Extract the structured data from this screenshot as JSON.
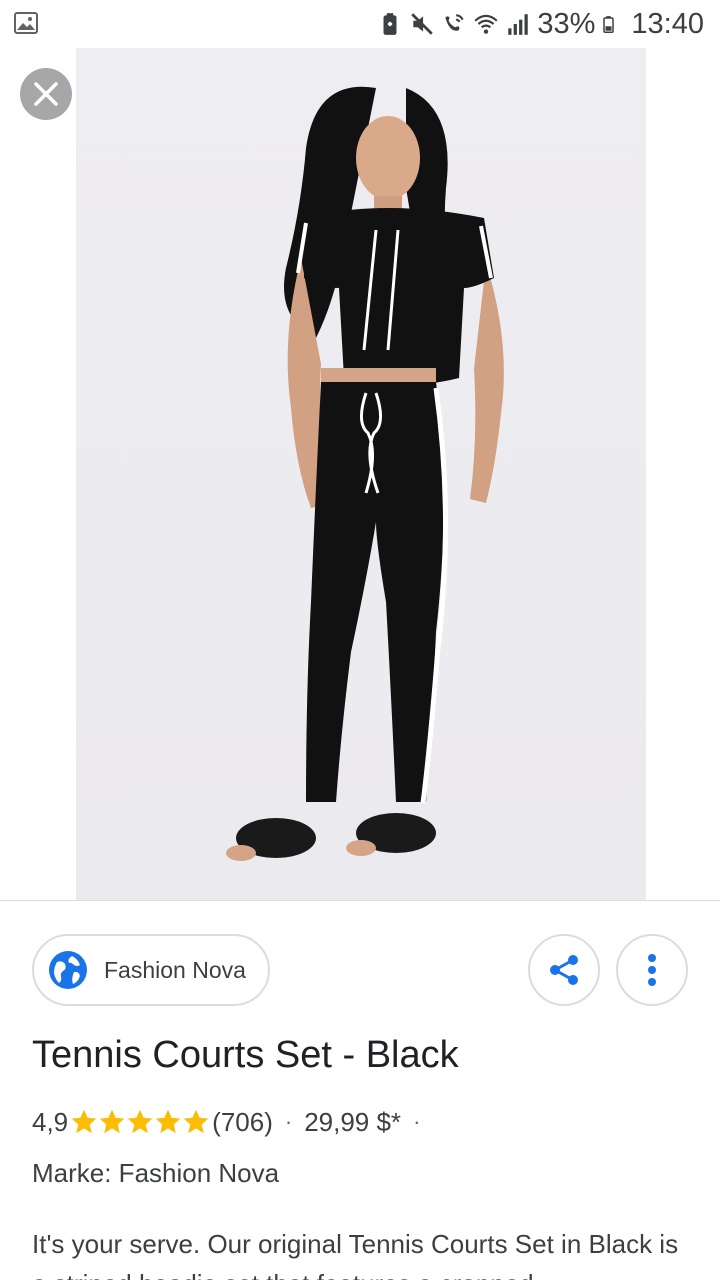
{
  "status_bar": {
    "battery": "33%",
    "time": "13:40"
  },
  "viewer": {
    "close_icon": "close-icon"
  },
  "source": {
    "name": "Fashion Nova",
    "icon": "globe-icon"
  },
  "actions": {
    "share_icon": "share-icon",
    "more_icon": "more-vert-icon"
  },
  "product": {
    "title": "Tennis Courts Set - Black",
    "rating": "4,9",
    "stars": 5,
    "review_count": "(706)",
    "price": "29,99 $*",
    "brand": "Marke: Fashion Nova",
    "description": "It's your serve. Our original Tennis Courts Set in Black is a striped hoodie set that features a cropped"
  },
  "colors": {
    "accent": "#1a73e8",
    "star": "#fbbc04",
    "text": "#202124"
  }
}
